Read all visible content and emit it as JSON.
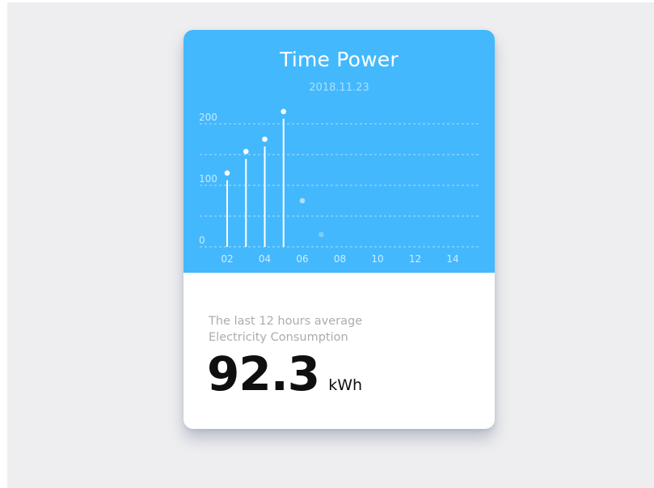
{
  "card": {
    "title": "Time Power",
    "date": "2018.11.23",
    "caption_line1": "The last 12 hours average",
    "caption_line2": "Electricity Consumption",
    "value": "92.3",
    "unit": "kWh"
  },
  "colors": {
    "background": "#eeeef0",
    "header": "#44b8fd",
    "value_text": "#0f0f0f",
    "caption_text": "#a9acb0"
  },
  "chart_data": {
    "type": "scatter",
    "title": "",
    "xlabel": "",
    "ylabel": "",
    "y_ticks": [
      "0",
      "100",
      "200"
    ],
    "x_ticks": [
      "02",
      "04",
      "06",
      "08",
      "10",
      "12",
      "14"
    ],
    "xlim": [
      1,
      15.5
    ],
    "ylim": [
      0,
      200
    ],
    "grid": true,
    "points": [
      {
        "x": 2,
        "y": 120,
        "stem": true,
        "opacity": 1
      },
      {
        "x": 3,
        "y": 155,
        "stem": true,
        "opacity": 1
      },
      {
        "x": 4,
        "y": 175,
        "stem": true,
        "opacity": 1
      },
      {
        "x": 5,
        "y": 220,
        "stem": true,
        "opacity": 1
      },
      {
        "x": 6,
        "y": 75,
        "stem": false,
        "opacity": 0.55
      },
      {
        "x": 7,
        "y": 20,
        "stem": false,
        "opacity": 0.3
      }
    ]
  }
}
